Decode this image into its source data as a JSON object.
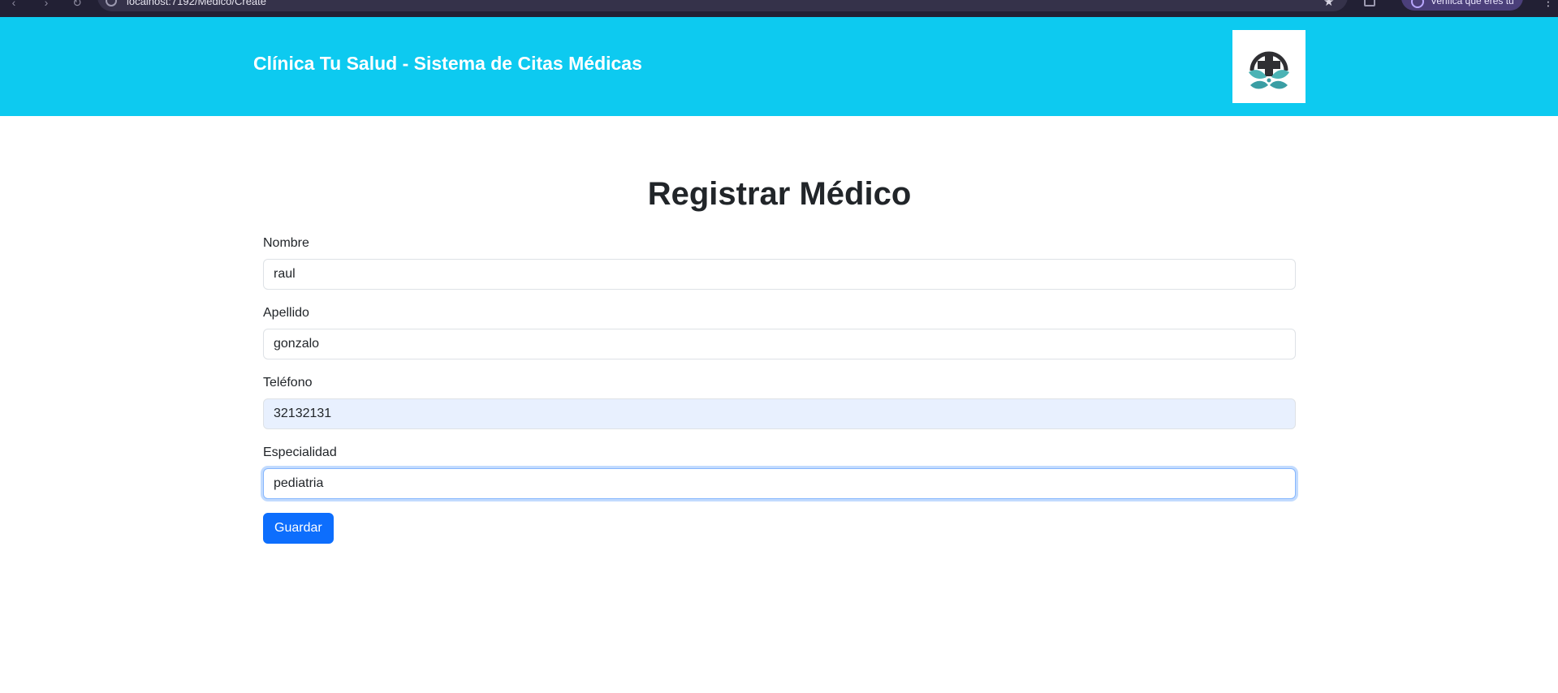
{
  "browser": {
    "url": "localhost:7192/Medico/Create",
    "profile_label": "Verifica que eres tú"
  },
  "header": {
    "title": "Clínica Tu Salud - Sistema de Citas Médicas",
    "background_color": "#0dcaf0",
    "logo_icon": "medical-cross-leaves-logo"
  },
  "page": {
    "title": "Registrar Médico"
  },
  "form": {
    "fields": [
      {
        "label": "Nombre",
        "value": "raul"
      },
      {
        "label": "Apellido",
        "value": "gonzalo"
      },
      {
        "label": "Teléfono",
        "value": "32132131"
      },
      {
        "label": "Especialidad",
        "value": "pediatria"
      }
    ],
    "submit_label": "Guardar",
    "primary_color": "#0d6efd"
  }
}
